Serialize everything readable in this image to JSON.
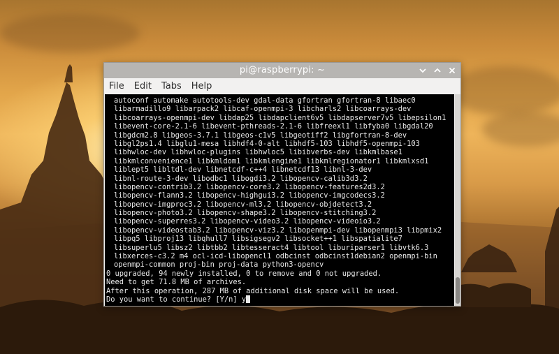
{
  "window": {
    "title": "pi@raspberrypi: ~"
  },
  "menu": [
    "File",
    "Edit",
    "Tabs",
    "Help"
  ],
  "terminal": {
    "package_lines": [
      "autoconf automake autotools-dev gdal-data gfortran gfortran-8 libaec0",
      "libarmadillo9 libarpack2 libcaf-openmpi-3 libcharls2 libcoarrays-dev",
      "libcoarrays-openmpi-dev libdap25 libdapclient6v5 libdapserver7v5 libepsilon1",
      "libevent-core-2.1-6 libevent-pthreads-2.1-6 libfreexl1 libfyba0 libgdal20",
      "libgdcm2.8 libgeos-3.7.1 libgeos-c1v5 libgeotiff2 libgfortran-8-dev",
      "libgl2ps1.4 libglu1-mesa libhdf4-0-alt libhdf5-103 libhdf5-openmpi-103",
      "libhwloc-dev libhwloc-plugins libhwloc5 libibverbs-dev libkmlbase1",
      "libkmlconvenience1 libkmldom1 libkmlengine1 libkmlregionator1 libkmlxsd1",
      "liblept5 libltdl-dev libnetcdf-c++4 libnetcdf13 libnl-3-dev",
      "libnl-route-3-dev libodbc1 libogdi3.2 libopencv-calib3d3.2",
      "libopencv-contrib3.2 libopencv-core3.2 libopencv-features2d3.2",
      "libopencv-flann3.2 libopencv-highgui3.2 libopencv-imgcodecs3.2",
      "libopencv-imgproc3.2 libopencv-ml3.2 libopencv-objdetect3.2",
      "libopencv-photo3.2 libopencv-shape3.2 libopencv-stitching3.2",
      "libopencv-superres3.2 libopencv-video3.2 libopencv-videoio3.2",
      "libopencv-videostab3.2 libopencv-viz3.2 libopenmpi-dev libopenmpi3 libpmix2",
      "libpq5 libproj13 libqhull7 libsigsegv2 libsocket++1 libspatialite7",
      "libsuperlu5 libsz2 libtbb2 libtesseract4 libtool liburiparser1 libvtk6.3",
      "libxerces-c3.2 m4 ocl-icd-libopencl1 odbcinst odbcinst1debian2 openmpi-bin",
      "openmpi-common proj-bin proj-data python3-opencv"
    ],
    "summary_lines": [
      "0 upgraded, 94 newly installed, 0 to remove and 0 not upgraded.",
      "Need to get 71.8 MB of archives.",
      "After this operation, 287 MB of additional disk space will be used."
    ],
    "prompt": "Do you want to continue? [Y/n] y"
  },
  "icons": {
    "minimize": "minimize-icon",
    "maximize": "maximize-icon",
    "close": "close-icon"
  },
  "colors": {
    "terminal_bg": "#000000",
    "terminal_fg": "#e8e8e8",
    "titlebar": "#b7b5b2"
  }
}
